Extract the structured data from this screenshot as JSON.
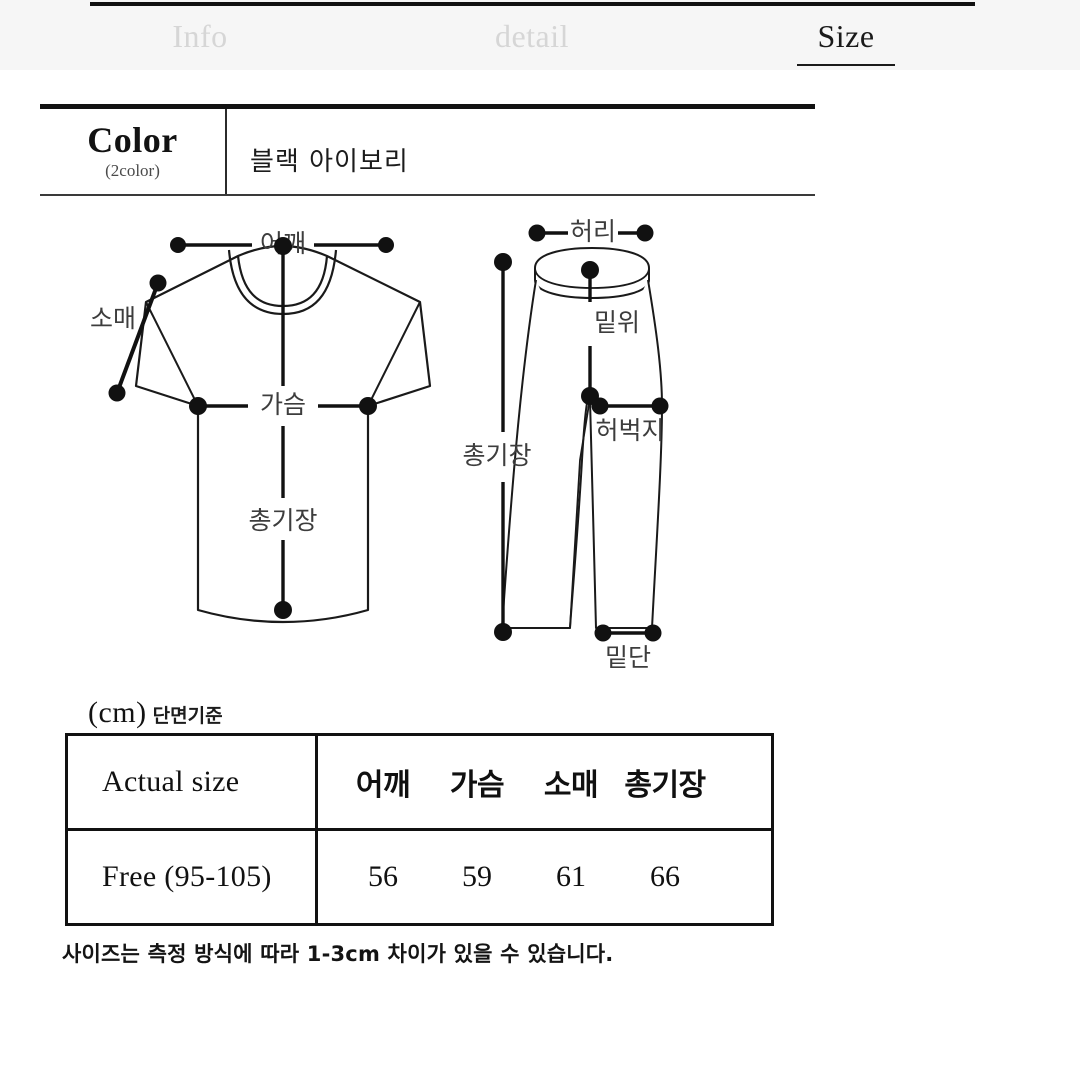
{
  "tabs": [
    {
      "label": "Info",
      "active": false
    },
    {
      "label": "detail",
      "active": false
    },
    {
      "label": "Size",
      "active": true
    }
  ],
  "color_section": {
    "title": "Color",
    "subtitle": "(2color)",
    "value": "블랙  아이보리"
  },
  "diagrams": {
    "top": {
      "name": "t-shirt",
      "labels": {
        "shoulder": "어깨",
        "sleeve": "소매",
        "chest": "가슴",
        "length": "총기장"
      }
    },
    "bottom": {
      "name": "pants",
      "labels": {
        "waist": "허리",
        "rise": "밑위",
        "thigh": "허벅지",
        "length": "총기장",
        "hem": "밑단"
      }
    }
  },
  "size_table": {
    "caption_unit": "(cm)",
    "caption_note": "단면기준",
    "header": {
      "label": "Actual size",
      "columns": [
        "어깨",
        "가슴",
        "소매",
        "총기장"
      ]
    },
    "rows": [
      {
        "label": "Free (95-105)",
        "values": [
          "56",
          "59",
          "61",
          "66"
        ]
      }
    ]
  },
  "footer_note": "사이즈는 측정 방식에 따라 1-3cm 차이가 있을 수 있습니다.",
  "colors": {
    "ink": "#111111",
    "muted_tab": "#d6d6d6",
    "bar_bg": "#f6f6f6",
    "label_gray": "#3d3d3d"
  }
}
